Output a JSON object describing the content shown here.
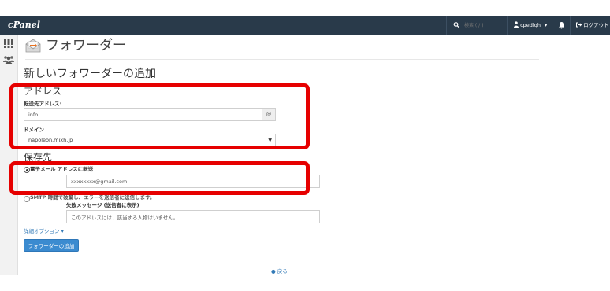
{
  "header": {
    "logo": "cPanel",
    "search_placeholder": "検索 ( / )",
    "username": "cpedlqh",
    "user_caret": "▾",
    "logout_label": "ログアウト"
  },
  "page": {
    "title": "フォワーダー",
    "section_title": "新しいフォワーダーの追加"
  },
  "address": {
    "heading": "アドレス",
    "label": "転送先アドレス:",
    "value": "info",
    "at_symbol": "@",
    "domain_label": "ドメイン",
    "domain_value": "napoleon.mixh.jp",
    "domain_caret": "▼"
  },
  "destination": {
    "heading": "保存先",
    "email_option_label": "電子メール アドレスに転送",
    "email_value": "xxxxxxxx@gmail.com",
    "fail_option_label": "SMTP 時間で破棄し、エラーを送信者に送信します。",
    "fail_message_label": "失敗メッセージ (送信者に表示)",
    "fail_message_value": "このアドレスには、該当する人物はいません。"
  },
  "actions": {
    "advanced_label": "詳細オプション ▾",
    "add_button": "フォワーダーの追加",
    "back_icon": "●",
    "back_label": "戻る"
  },
  "colors": {
    "topbar": "#293a4a",
    "highlight": "#e60000",
    "button": "#3b8bd0",
    "link": "#337ab7"
  },
  "icons": [
    "search-icon",
    "user-icon",
    "bell-icon",
    "logout-icon",
    "grid-icon",
    "users-icon",
    "forwarder-icon"
  ]
}
